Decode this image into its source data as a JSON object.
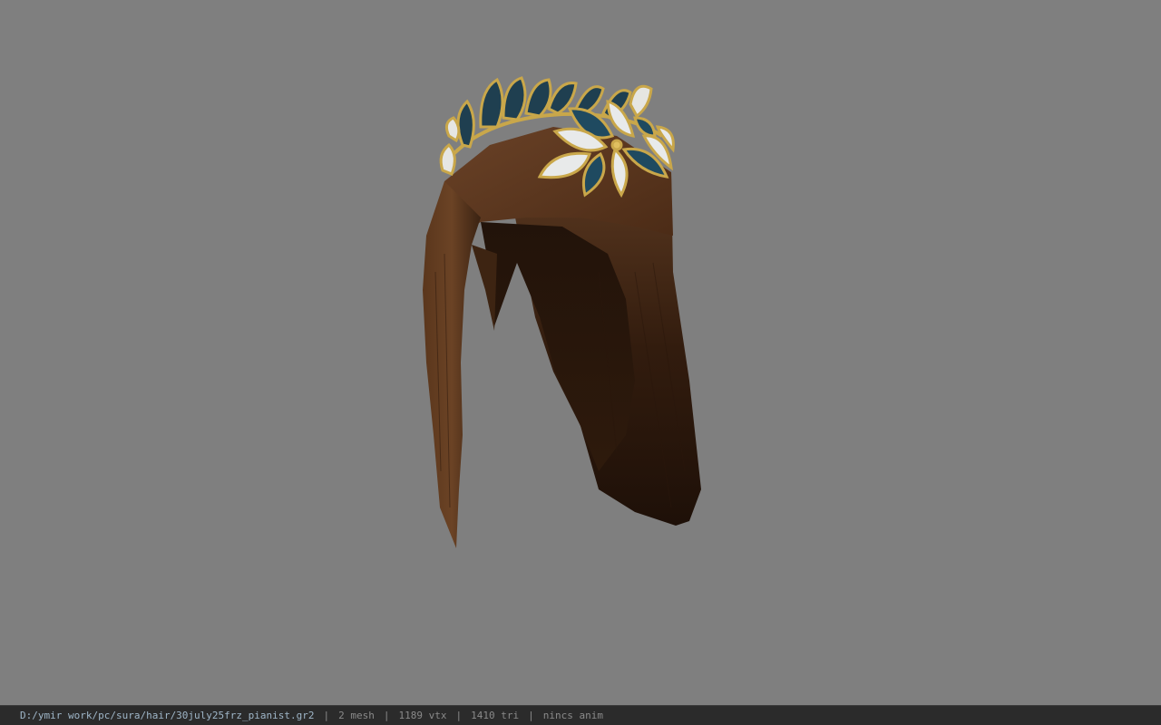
{
  "viewport": {
    "background": "#7f7f7f",
    "model_icon": "hair-with-laurel-crown-3d-model"
  },
  "statusbar": {
    "file_path": "D:/ymir work/pc/sura/hair/30july25frz_pianist.gr2",
    "separator": "|",
    "mesh_count": "2 mesh",
    "vertex_count": "1189 vtx",
    "triangle_count": "1410 tri",
    "anim_status": "nincs anim"
  },
  "colors": {
    "hair_dark": "#2a170c",
    "hair_mid": "#4a2a16",
    "hair_light": "#6a4226",
    "gold": "#c9a74a",
    "leaf_blue": "#1f4a60",
    "leaf_white": "#e8eaea"
  }
}
